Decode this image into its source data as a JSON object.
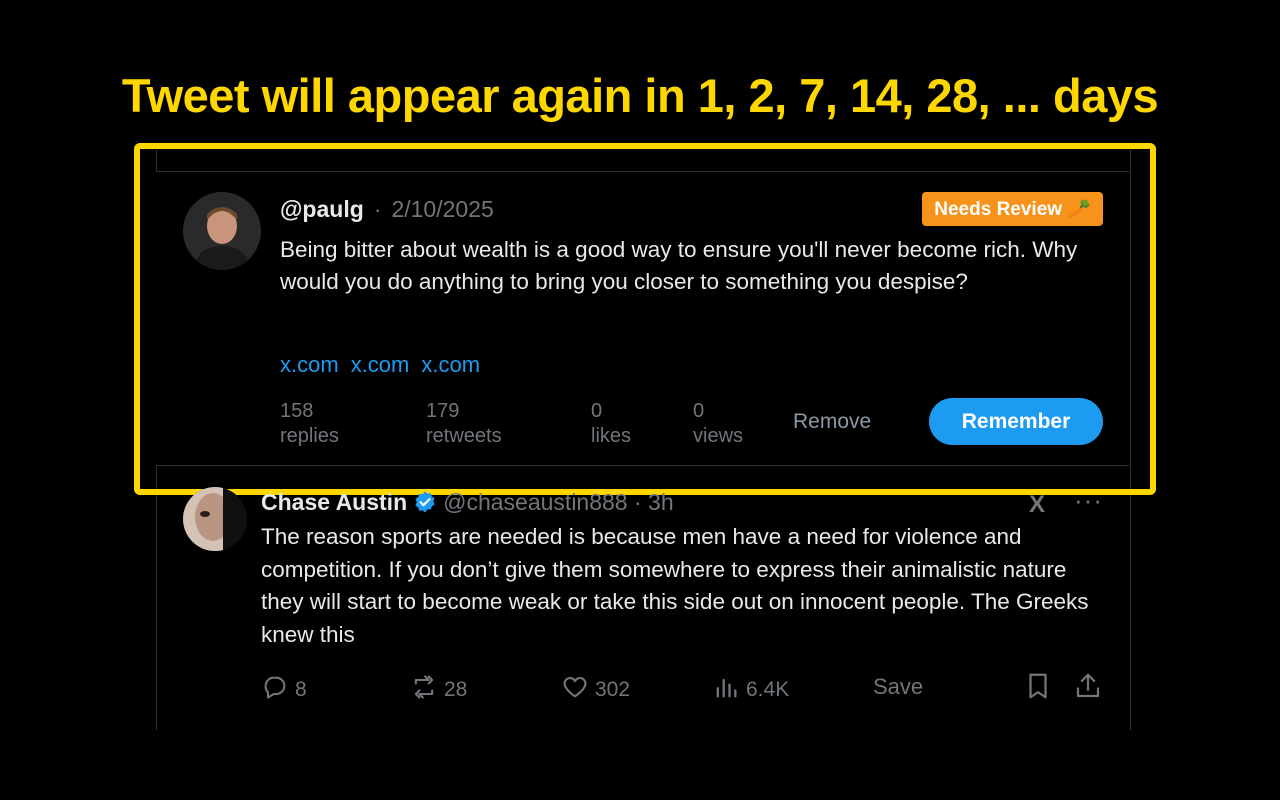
{
  "headline": "Tweet will appear again in 1, 2, 7, 14, 28, ... days",
  "colors": {
    "highlight": "#ffd700",
    "badge": "#f7931a",
    "link": "#1d9bf0",
    "button": "#1d9bf0",
    "muted": "#71767b"
  },
  "review_card": {
    "handle": "@paulg",
    "separator": "·",
    "date": "2/10/2025",
    "badge": "Needs Review 🥕",
    "text": "Being bitter about wealth is a good way to ensure you'll never become rich. Why would you do anything to bring you closer to something you despise?",
    "links": [
      "x.com",
      "x.com",
      "x.com"
    ],
    "stats": [
      {
        "value": "158",
        "label": "replies"
      },
      {
        "value": "179",
        "label": "retweets"
      },
      {
        "value": "0",
        "label": "likes"
      },
      {
        "value": "0",
        "label": "views"
      }
    ],
    "remove_label": "Remove",
    "remember_label": "Remember"
  },
  "feed_tweet": {
    "name": "Chase Austin",
    "verified_icon": "verified-badge-icon",
    "handle": "@chaseaustin888",
    "time": "· 3h",
    "text": "The reason sports are needed is because men have a need for violence and competition. If you don’t give them somewhere to express their animalistic nature they will start to become weak or take this side out on innocent people. The Greeks knew this",
    "x_logo": "X",
    "more": "···",
    "actions": {
      "replies": "8",
      "reposts": "28",
      "likes": "302",
      "views": "6.4K"
    },
    "save_label": "Save",
    "icons": [
      "reply-icon",
      "repost-icon",
      "like-icon",
      "views-icon",
      "bookmark-icon",
      "share-icon"
    ]
  }
}
